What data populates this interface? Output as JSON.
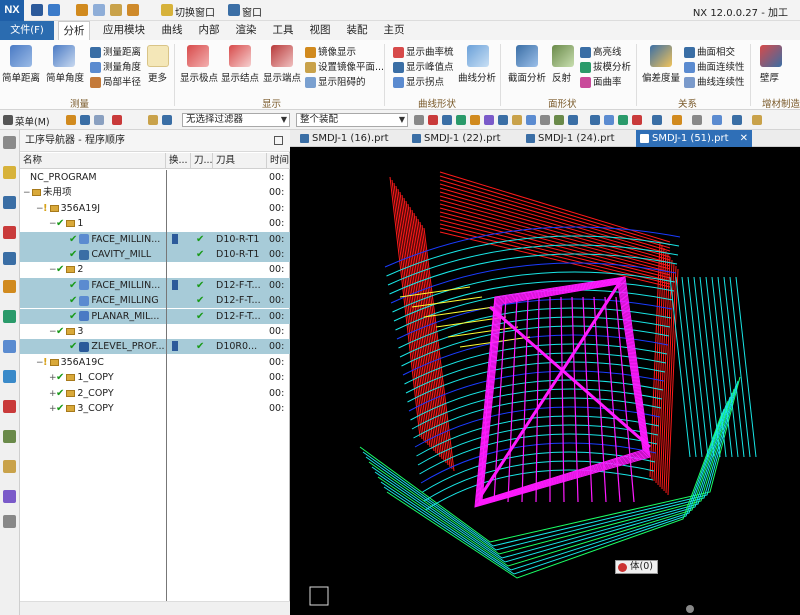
{
  "app": {
    "logo": "NX",
    "title": "NX 12.0.0.27 - 加工",
    "switch_window": "切换窗口",
    "window_menu": "窗口"
  },
  "ribbon_tabs": [
    "文件(F)",
    "分析",
    "应用模块",
    "曲线",
    "内部",
    "渲染",
    "工具",
    "视图",
    "装配",
    "主页"
  ],
  "ribbon": {
    "measure": {
      "simple_distance": "简单距离",
      "simple_angle": "简单角度",
      "measure_distance": "测量距离",
      "measure_angle": "测量角度",
      "local_radius": "局部半径",
      "more": "更多",
      "group": "测量"
    },
    "display": {
      "show_poles": "显示极点",
      "show_knots": "显示结点",
      "show_endpoints": "显示端点",
      "mirror_display": "镜像显示",
      "set_mirror_plane": "设置镜像平面...",
      "show_obstructed": "显示阻碍的",
      "group": "显示"
    },
    "curve_shape": {
      "show_curvature_comb": "显示曲率梳",
      "show_peak_points": "显示峰值点",
      "show_inflections": "显示拐点",
      "curve_analysis": "曲线分析",
      "group": "曲线形状"
    },
    "face_shape": {
      "section_analysis": "截面分析",
      "reflection": "反射",
      "highlight_lines": "高亮线",
      "draft_analysis": "拔模分析",
      "face_curvature": "面曲率",
      "group": "面形状"
    },
    "relation": {
      "deviation": "偏差度量",
      "face_intersect": "曲面相交",
      "face_continuity": "曲面连续性",
      "curve_continuity": "曲线连续性",
      "group": "关系"
    },
    "material": {
      "thickness": "壁厚",
      "group": "增材制造"
    }
  },
  "cmdbar": {
    "menu": "菜单(M)",
    "filter": "无选择过滤器",
    "scope": "整个装配"
  },
  "navigator": {
    "title": "工序导航器 - 程序顺序",
    "columns": [
      "名称",
      "换...",
      "刀...",
      "刀具",
      "时间"
    ],
    "rows": [
      {
        "indent": 0,
        "name": "NC_PROGRAM",
        "kind": "root",
        "tool": "",
        "time": "00:"
      },
      {
        "indent": 0,
        "name": "未用项",
        "kind": "folder",
        "tool": "",
        "time": "00:"
      },
      {
        "indent": 1,
        "name": "356A19J",
        "kind": "program",
        "tool": "",
        "time": "00:"
      },
      {
        "indent": 2,
        "name": "1",
        "kind": "group",
        "tool": "",
        "time": "00:"
      },
      {
        "indent": 3,
        "name": "FACE_MILLIN...",
        "kind": "op-face",
        "sel": true,
        "change": true,
        "path": true,
        "tool": "D10-R-T1",
        "time": "00:"
      },
      {
        "indent": 3,
        "name": "CAVITY_MILL",
        "kind": "op-cavity",
        "sel": true,
        "change": false,
        "path": true,
        "tool": "D10-R-T1",
        "time": "00:"
      },
      {
        "indent": 2,
        "name": "2",
        "kind": "group",
        "tool": "",
        "time": "00:"
      },
      {
        "indent": 3,
        "name": "FACE_MILLIN...",
        "kind": "op-face",
        "sel": true,
        "change": true,
        "path": true,
        "tool": "D12-F-T...",
        "time": "00:"
      },
      {
        "indent": 3,
        "name": "FACE_MILLING",
        "kind": "op-face",
        "sel": true,
        "change": false,
        "path": true,
        "tool": "D12-F-T...",
        "time": "00:"
      },
      {
        "indent": 3,
        "name": "PLANAR_MIL...",
        "kind": "op-planar",
        "sel": true,
        "change": false,
        "path": true,
        "tool": "D12-F-T...",
        "time": "00:"
      },
      {
        "indent": 2,
        "name": "3",
        "kind": "group",
        "tool": "",
        "time": "00:"
      },
      {
        "indent": 3,
        "name": "ZLEVEL_PROF...",
        "kind": "op-zlevel",
        "sel": true,
        "change": true,
        "path": true,
        "tool": "D10R0...",
        "time": "00:"
      },
      {
        "indent": 1,
        "name": "356A19C",
        "kind": "program",
        "tool": "",
        "time": "00:"
      },
      {
        "indent": 2,
        "name": "1_COPY",
        "kind": "group-collapsed",
        "tool": "",
        "time": "00:"
      },
      {
        "indent": 2,
        "name": "2_COPY",
        "kind": "group-collapsed",
        "tool": "",
        "time": "00:"
      },
      {
        "indent": 2,
        "name": "3_COPY",
        "kind": "group-collapsed",
        "tool": "",
        "time": "00:"
      }
    ]
  },
  "view_tabs": [
    {
      "label": "SMDJ-1 (16).prt",
      "active": false
    },
    {
      "label": "SMDJ-1 (22).prt",
      "active": false
    },
    {
      "label": "SMDJ-1 (24).prt",
      "active": false
    },
    {
      "label": "SMDJ-1 (51).prt",
      "active": true
    }
  ],
  "viewport": {
    "body_tag": "体(0)"
  },
  "colors": {
    "path_red": "#ff1a1a",
    "path_cyan": "#19e6e6",
    "path_magenta": "#ff1aff",
    "path_blue": "#1a3cff",
    "path_green": "#1aff66",
    "path_yellow": "#ffff33",
    "selection": "#a7cbd8",
    "ribbon_accent": "#2b6cb0"
  }
}
